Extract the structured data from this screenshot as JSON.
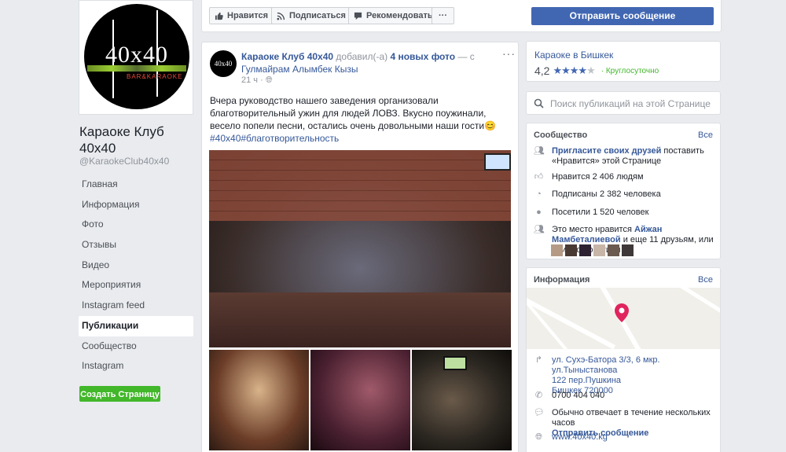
{
  "page": {
    "logo_text": "40x40",
    "logo_sub": "BAR&KARAOKE",
    "name": "Караоке Клуб 40x40",
    "handle": "@KaraokeClub40x40"
  },
  "nav": {
    "items": [
      {
        "label": "Главная"
      },
      {
        "label": "Информация"
      },
      {
        "label": "Фото"
      },
      {
        "label": "Отзывы"
      },
      {
        "label": "Видео"
      },
      {
        "label": "Мероприятия"
      },
      {
        "label": "Instagram feed"
      },
      {
        "label": "Публикации"
      },
      {
        "label": "Сообщество"
      },
      {
        "label": "Instagram"
      }
    ],
    "active": "Публикации",
    "create_button": "Создать Страницу"
  },
  "actions": {
    "like": "Нравится",
    "follow": "Подписаться",
    "recommend": "Рекомендовать",
    "more": "···",
    "send_message": "Отправить сообщение"
  },
  "post": {
    "avatar_text": "40x40",
    "author": "Караоке Клуб 40x40",
    "added": "добавил(-а)",
    "photos_count": "4 новых фото",
    "with": "— с",
    "tagged": "Гулмайрам Алымбек Кызы",
    "time": "21 ч",
    "privacy_icon": "globe-icon",
    "menu": "···",
    "text": "Вчера руководство нашего заведения организовали благотворительный ужин для людей ЛОВЗ. Вкусно поужинали, весело попели песни, остались очень довольными наши гости😊",
    "hashtag1": "#40x40",
    "hashtag2": "#благотворительность"
  },
  "category": {
    "title": "Караоке в Бишкек",
    "rating": "4,2",
    "stars_filled": 4,
    "stars_total": 5,
    "hours": "Круглосуточно"
  },
  "search": {
    "placeholder": "Поиск публикаций на этой Странице"
  },
  "community": {
    "title": "Сообщество",
    "see_all": "Все",
    "invite_link": "Пригласите своих друзей",
    "invite_rest": " поставить «Нравится» этой Странице",
    "likes": "Нравится 2 406 людям",
    "followers": "Подписаны 2 382 человека",
    "visits": "Посетили 1 520 человек",
    "friends_prefix": "Это место нравится ",
    "friend_name": "Айжан Мамбеталиевой",
    "friends_suffix": " и еще 11 друзьям, или они его посетили"
  },
  "info": {
    "title": "Информация",
    "see_all": "Все",
    "address_line1": "ул. Сухэ-Батора 3/3, 6 мкр. ул.Тыныстанова",
    "address_line2": "122 пер.Пушкина",
    "address_line3": "Бишкек 720000",
    "phone": "0700 404 040",
    "response": "Обычно отвечает в течение нескольких часов",
    "send_message": "Отправить сообщение",
    "website": "www.40x40.kg"
  },
  "colors": {
    "brand_blue": "#4267b2",
    "link": "#365899",
    "green": "#42b72a",
    "pin": "#e0245e"
  }
}
